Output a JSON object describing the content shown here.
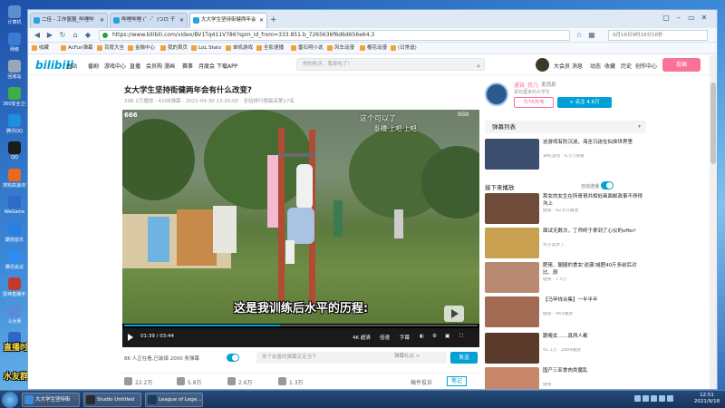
{
  "desktop": {
    "icons": [
      {
        "label": "计算机",
        "color": "#5d8fd0"
      },
      {
        "label": "网络",
        "color": "#3a7bd5"
      },
      {
        "label": "回收站",
        "color": "#9aa7b5"
      },
      {
        "label": "360安全卫士",
        "color": "#3fae49"
      },
      {
        "label": "腾讯QQ",
        "color": "#1d8fe0"
      },
      {
        "label": "QQ",
        "color": "#1b1b1b"
      },
      {
        "label": "搜狗高速浏览器",
        "color": "#e86b1d"
      },
      {
        "label": "WeGame",
        "color": "#2e6ac8"
      },
      {
        "label": "酷狗音乐",
        "color": "#2b7ee3"
      },
      {
        "label": "腾讯会议",
        "color": "#2f8cf0"
      },
      {
        "label": "雷神直播平台",
        "color": "#c23a2e"
      },
      {
        "label": "斗大师",
        "color": "#5b8bd8"
      },
      {
        "label": "QQ游戏",
        "color": "#2c69c7"
      }
    ],
    "overlay_line1": "直播时间：早10点-下3点",
    "overlay_line2": "晚8点-11点",
    "overlay_line3": "水友群：362583518"
  },
  "browser": {
    "tabs": [
      {
        "label": "二佳 - 工作篮圈_哔哩哔",
        "active": false
      },
      {
        "label": "哔哩哔哩 (゜-゜)つロ 干",
        "active": false
      },
      {
        "label": "大大学生坚持街健两年会",
        "active": true
      }
    ],
    "window_controls": [
      "▢",
      "–",
      "▭",
      "✕"
    ],
    "url": "https://www.bilibili.com/video/BV1Tq411V786?spm_id_from=333.851.b_7265636f6d6d656e64.3",
    "search_placeholder": "9月18日9时18分18秒",
    "bookmarks": [
      "收藏",
      "AcFun弹幕",
      "百度大全",
      "金融中心",
      "我的首页",
      "LoL Stats",
      "单机游戏",
      "全影速播",
      "雷石明小说",
      "风车动漫",
      "樱花动漫",
      "(日常追)"
    ]
  },
  "site": {
    "logo": "bilibili",
    "nav": [
      "主站",
      "番剧",
      "游戏中心",
      "直播",
      "会员购",
      "漫画",
      "赛事",
      "月度会",
      "下载APP"
    ],
    "search_placeholder": "你的秋天，我承包了!",
    "right_nav": [
      "大会员",
      "消息",
      "动态",
      "收藏",
      "历史",
      "创作中心"
    ],
    "upload_label": "投稿"
  },
  "video": {
    "title": "女大学生坚持街健两年会有什么改变?",
    "meta": "298.1万播放 · 4208弹幕 · 2021-09-30 23:20:00 · 全站排行榜最高第17名",
    "counter": "666",
    "danmaku_line1": "这个可以了",
    "danmaku_line2": "卧槽·上吧·上吧",
    "corner_mark": "BBB",
    "subtitle": "这是我训练后水平的历程:",
    "time": "01:39 / 03:44",
    "progress": 0.44,
    "controls": [
      "4K 超清",
      "倍速",
      "字幕"
    ],
    "danmaku_count": "86 人正在看,已装填 2000 条弹幕",
    "danmaku_placeholder": "发个友善的弹幕见证当下",
    "danmaku_etiquette": "弹幕礼仪 >",
    "send_label": "发送",
    "actions": [
      {
        "label": "22.2万",
        "icon": "like-icon"
      },
      {
        "label": "5.8万",
        "icon": "coin-icon"
      },
      {
        "label": "2.6万",
        "icon": "star-icon"
      },
      {
        "label": "1.3万",
        "icon": "share-icon"
      }
    ],
    "extra_label": "稿件投诉",
    "note_label": "笔记"
  },
  "uploader": {
    "name": "通宵_我几",
    "send_msg": "发消息",
    "desc": "喜欢健身的大学生",
    "charge": "为TA充电",
    "follow": "+ 关注 4.6万"
  },
  "sidebar": {
    "danmaku_list": "弹幕列表",
    "next_label": "接下来播放",
    "autoplay_label": "自动连播",
    "recs": [
      {
        "title": "这游戏有防沉迷，海全沉迷在仙侠世界里",
        "stat": "单机游戏 · 6.5万观看",
        "color": "#3c4e6e"
      },
      {
        "title": "那女的女生在所哥哥共相处画面邮政事不停得沟上",
        "stat": "健身 · 92.6万播放",
        "color": "#6f4b3a"
      },
      {
        "title": "面试无数次，丁师终于拿到了心仪的offer!",
        "stat": "丸子追梦了",
        "color": "#c9a050"
      },
      {
        "title": "肥佬、腿腿的食女'逆袭'减肥40斤多前后对比、颜",
        "stat": "健身 · 7.5万",
        "color": "#b98a72"
      },
      {
        "title": "【马甲线合集】一半半半",
        "stat": "健身 · 463播放",
        "color": "#a26a52"
      },
      {
        "title": "跟俺女……真两人都",
        "stat": "42.1万 · 2889播放",
        "color": "#5a3a2a"
      },
      {
        "title": "国产三亚食肉类魔乱",
        "stat": "健身",
        "color": "#c9876a"
      }
    ]
  },
  "taskbar": {
    "items": [
      {
        "label": "大大学生坚持街",
        "color": "#3a8be0"
      },
      {
        "label": "Studio Untitled",
        "color": "#2a2a2a"
      },
      {
        "label": "League of Lege...",
        "color": "#1a3a5a"
      }
    ],
    "time": "12:51",
    "date": "2021/9/18"
  }
}
